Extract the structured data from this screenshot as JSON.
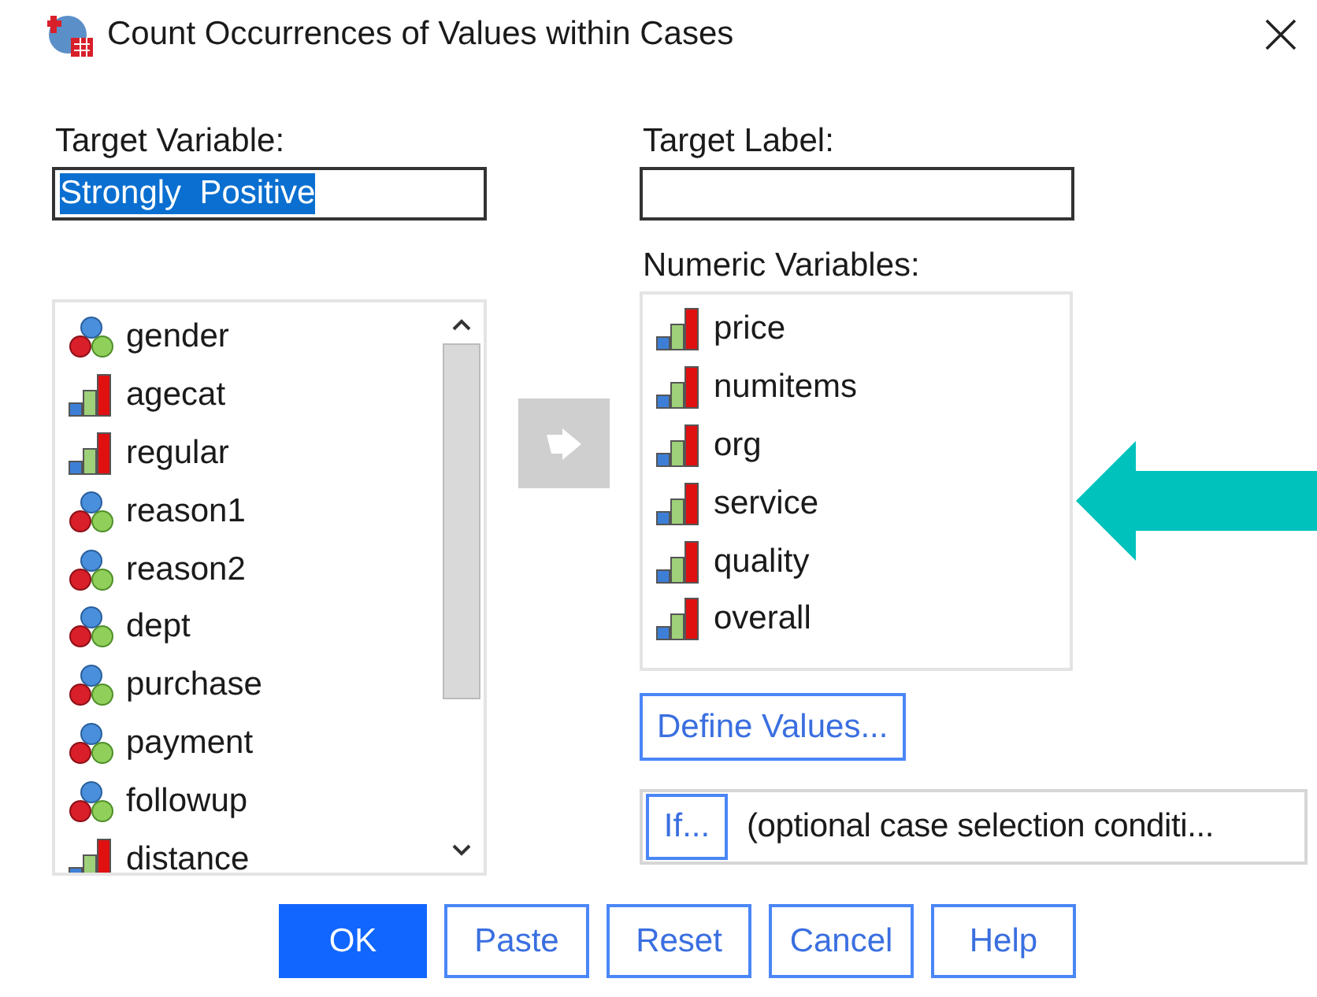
{
  "window": {
    "title": "Count Occurrences of Values within Cases"
  },
  "target_variable": {
    "label": "Target Variable:",
    "value": "Strongly  Positive",
    "selected": true
  },
  "target_label": {
    "label": "Target Label:"
  },
  "source_list": {
    "items": [
      {
        "name": "gender",
        "kind": "nominal"
      },
      {
        "name": "agecat",
        "kind": "ordinal"
      },
      {
        "name": "regular",
        "kind": "ordinal"
      },
      {
        "name": "reason1",
        "kind": "nominal"
      },
      {
        "name": "reason2",
        "kind": "nominal"
      },
      {
        "name": "dept",
        "kind": "nominal"
      },
      {
        "name": "purchase",
        "kind": "nominal"
      },
      {
        "name": "payment",
        "kind": "nominal"
      },
      {
        "name": "followup",
        "kind": "nominal"
      },
      {
        "name": "distance",
        "kind": "ordinal"
      }
    ]
  },
  "move_button": {
    "disabled": true
  },
  "numeric_variables": {
    "label": "Numeric Variables:",
    "items": [
      {
        "name": "price",
        "kind": "ordinal"
      },
      {
        "name": "numitems",
        "kind": "ordinal"
      },
      {
        "name": "org",
        "kind": "ordinal"
      },
      {
        "name": "service",
        "kind": "ordinal"
      },
      {
        "name": "quality",
        "kind": "ordinal"
      },
      {
        "name": "overall",
        "kind": "ordinal"
      }
    ]
  },
  "define_values_button": {
    "label": "Define Values..."
  },
  "if_row": {
    "button": {
      "label": "If..."
    },
    "condition": "(optional case selection conditi..."
  },
  "buttons": [
    {
      "label": "OK",
      "default": true
    },
    {
      "label": "Paste",
      "default": false
    },
    {
      "label": "Reset",
      "default": false
    },
    {
      "label": "Cancel",
      "default": false
    },
    {
      "label": "Help",
      "default": false
    }
  ]
}
